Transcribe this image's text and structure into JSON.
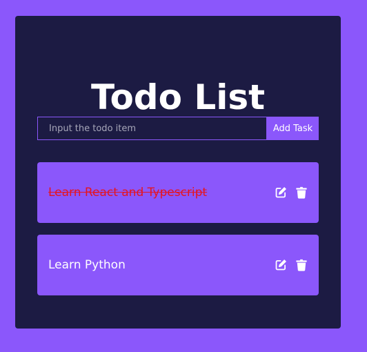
{
  "app": {
    "title": "Todo List"
  },
  "form": {
    "input_value": "",
    "input_placeholder": "Input the todo item",
    "add_button_label": "Add Task"
  },
  "todos": [
    {
      "text": "Learn React and Typescript",
      "completed": true,
      "edit_icon": "edit-icon",
      "delete_icon": "trash-icon"
    },
    {
      "text": "Learn Python",
      "completed": false,
      "edit_icon": "edit-icon",
      "delete_icon": "trash-icon"
    }
  ],
  "colors": {
    "background": "#8b57fb",
    "card": "#1c1b43",
    "accent": "#8b57fb",
    "completed_text": "#e5141f",
    "text": "#ffffff"
  }
}
